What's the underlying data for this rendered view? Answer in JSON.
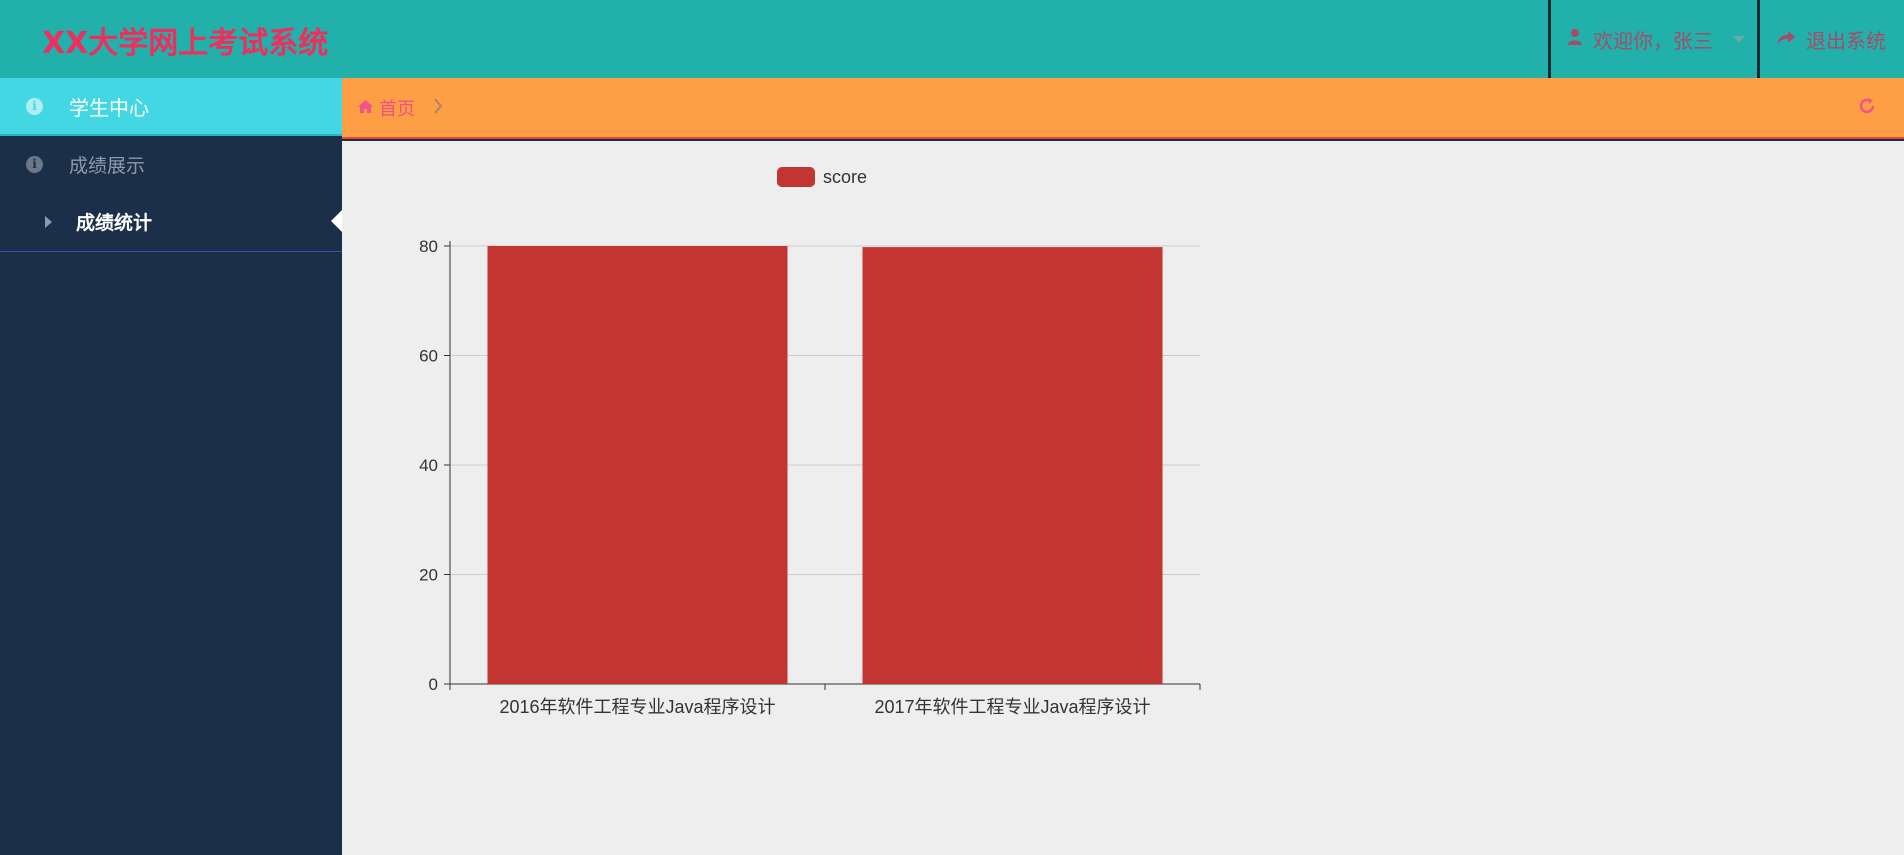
{
  "header": {
    "logo": "XX大学网上考试系统",
    "user_icon": "user-icon",
    "welcome": "欢迎你，张三",
    "logout_icon": "share-icon",
    "logout": "退出系统"
  },
  "sidebar": {
    "head_icon": "info-icon",
    "head_label": "学生中心",
    "group_icon": "info-icon",
    "group_label": "成绩展示",
    "item_icon": "caret-right-icon",
    "item_label": "成绩统计"
  },
  "breadcrumb": {
    "home_icon": "home-icon",
    "home": "首页",
    "separator_icon": "chevron-right-icon",
    "refresh_icon": "refresh-icon"
  },
  "colors": {
    "header_bg": "#21b0aa",
    "logo": "#ef2e5e",
    "sidebar_bg": "#1b2f48",
    "sidebar_active": "#43d7e3",
    "breadcrumb_bg": "#ff9f45",
    "bar": "#c23531"
  },
  "chart_data": {
    "type": "bar",
    "categories": [
      "2016年软件工程专业Java程序设计",
      "2017年软件工程专业Java程序设计"
    ],
    "series": [
      {
        "name": "score",
        "values": [
          80,
          79.8
        ]
      }
    ],
    "ylim": [
      0,
      80
    ],
    "yticks": [
      0,
      20,
      40,
      60,
      80
    ],
    "grid": true,
    "legend": "top-center"
  }
}
